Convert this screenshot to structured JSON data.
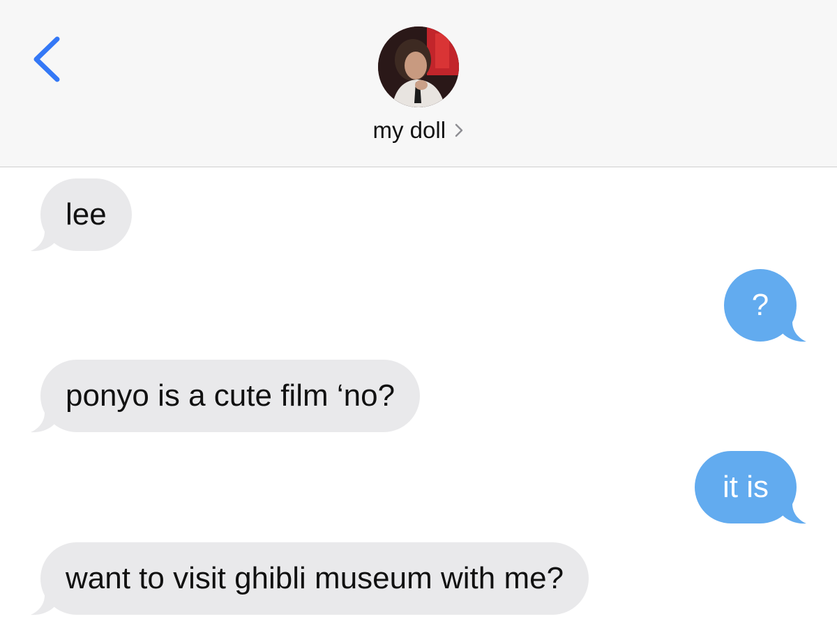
{
  "header": {
    "contact_name": "my doll"
  },
  "colors": {
    "accent": "#3478f6",
    "incoming_bubble": "#e9e9eb",
    "outgoing_bubble": "#62abef"
  },
  "messages": [
    {
      "direction": "incoming",
      "text": "lee"
    },
    {
      "direction": "outgoing",
      "text": "?"
    },
    {
      "direction": "incoming",
      "text": "ponyo is a cute film ‘no?"
    },
    {
      "direction": "outgoing",
      "text": "it is"
    },
    {
      "direction": "incoming",
      "text": "want to visit ghibli museum with me?"
    }
  ]
}
